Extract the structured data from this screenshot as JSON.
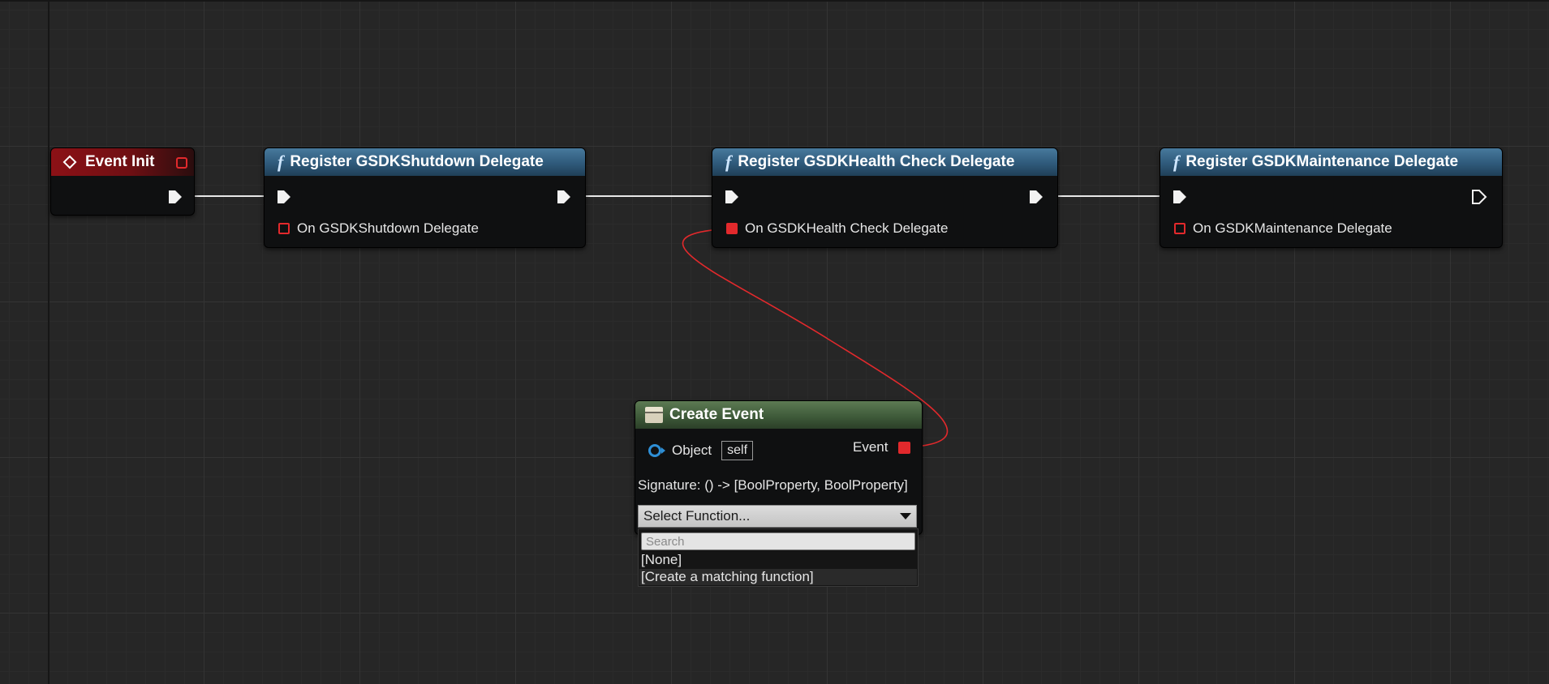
{
  "nodes": {
    "event_init": {
      "title": "Event Init"
    },
    "register_shutdown": {
      "title": "Register GSDKShutdown Delegate",
      "delegate_pin": "On GSDKShutdown Delegate"
    },
    "register_health": {
      "title": "Register GSDKHealth Check Delegate",
      "delegate_pin": "On GSDKHealth Check Delegate"
    },
    "register_maintenance": {
      "title": "Register GSDKMaintenance Delegate",
      "delegate_pin": "On GSDKMaintenance Delegate"
    },
    "create_event": {
      "title": "Create Event",
      "object_label": "Object",
      "object_value": "self",
      "event_label": "Event",
      "signature": "Signature: () -> [BoolProperty, BoolProperty]",
      "select_function": "Select Function...",
      "search_placeholder": "Search",
      "options": [
        "[None]",
        "[Create a matching function]"
      ]
    }
  },
  "colors": {
    "exec_wire": "#e8e8e8",
    "delegate_wire": "#e2292c",
    "function_header": "#2f5a7b",
    "event_header": "#8c1116",
    "create_event_header": "#3f5b3a"
  }
}
